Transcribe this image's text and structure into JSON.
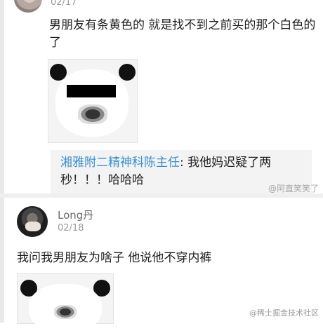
{
  "posts": [
    {
      "date": "02/17",
      "text": "男朋友有条黄色的 就是找不到之前买的那个白色的了",
      "quote": {
        "author": "湘雅附二精神科陈主任",
        "sep": ":",
        "text": "我他妈迟疑了两秒！！！哈哈哈"
      }
    },
    {
      "username": "Long丹",
      "date": "02/18",
      "text": "我问我男朋友为啥子 他说他不穿内裤"
    }
  ],
  "watermarks": {
    "weibo": "@阿直笑笑了",
    "juejin": "@稀土掘金技术社区"
  }
}
